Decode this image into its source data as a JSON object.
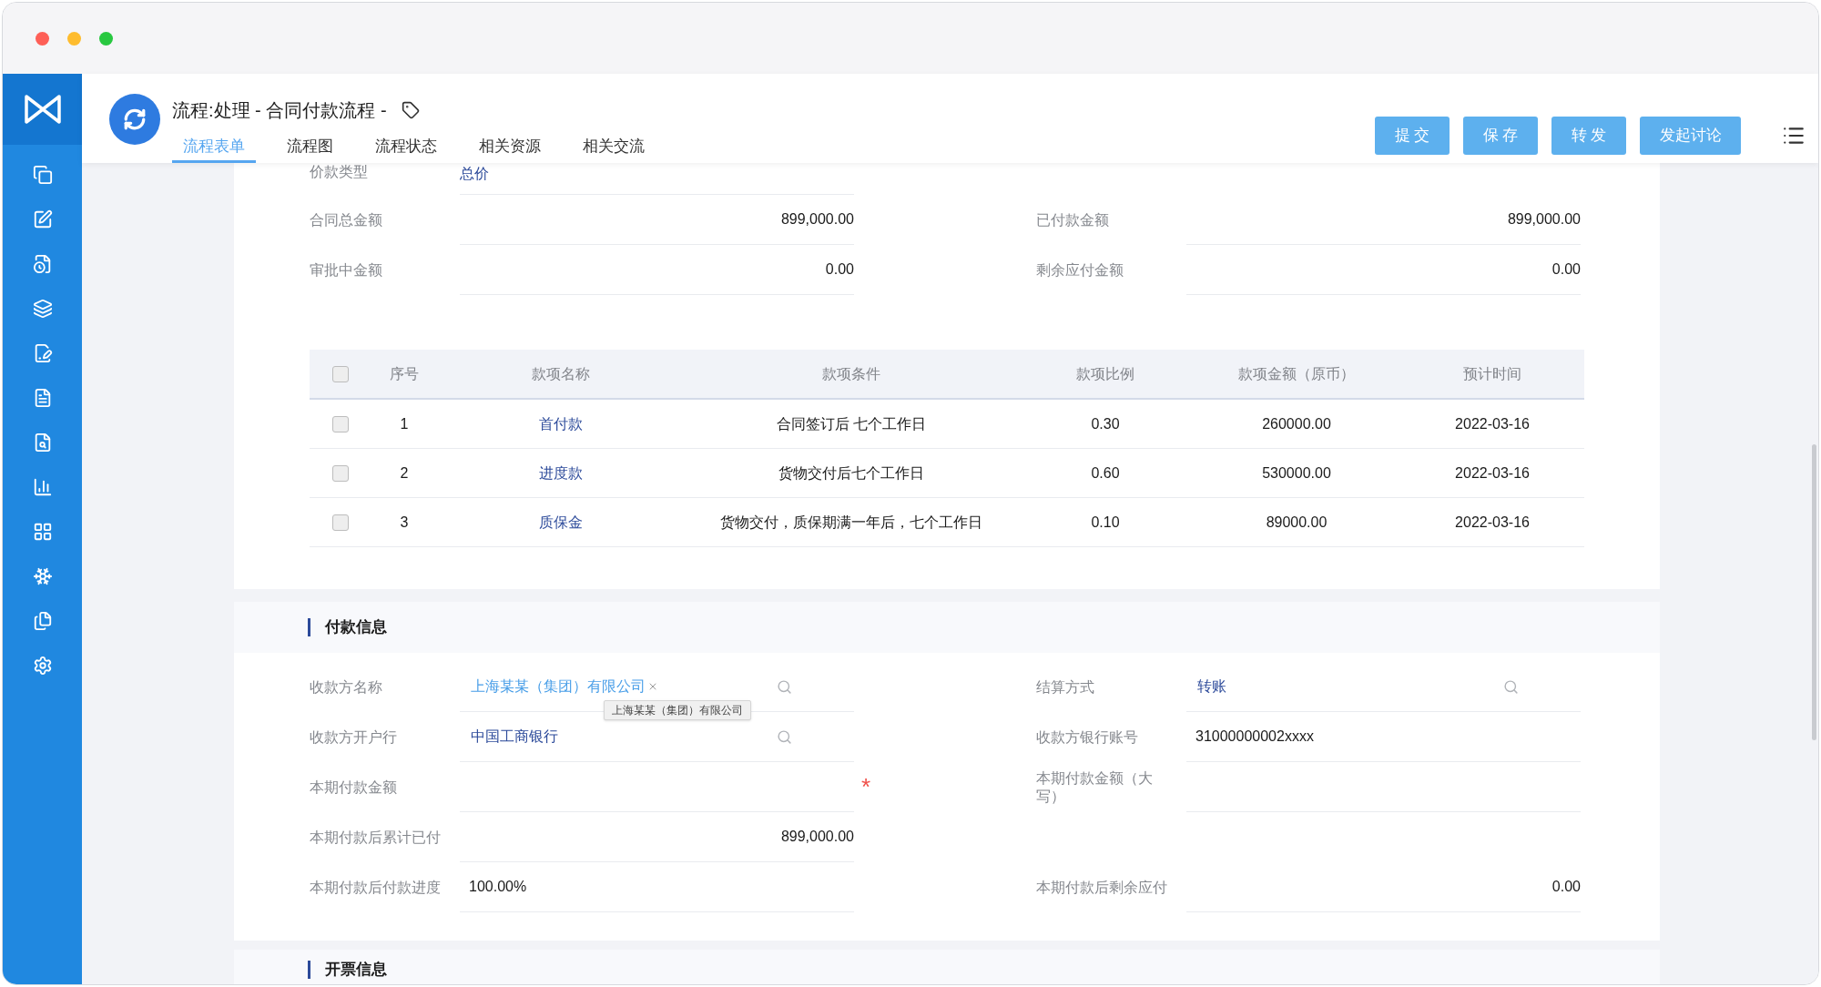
{
  "window": {
    "title": "流程:处理 - 合同付款流程 -"
  },
  "tabs": [
    {
      "label": "流程表单",
      "selected": true
    },
    {
      "label": "流程图",
      "selected": false
    },
    {
      "label": "流程状态",
      "selected": false
    },
    {
      "label": "相关资源",
      "selected": false
    },
    {
      "label": "相关交流",
      "selected": false
    }
  ],
  "actions": [
    "提 交",
    "保 存",
    "转 发",
    "发起讨论"
  ],
  "contract_fields": [
    {
      "left": {
        "label": "价款类型",
        "value": "总价",
        "kind": "link"
      }
    },
    {
      "left": {
        "label": "合同总金额",
        "value": "899,000.00",
        "kind": "amount"
      },
      "right": {
        "label": "已付款金额",
        "value": "899,000.00",
        "kind": "amount"
      }
    },
    {
      "left": {
        "label": "审批中金额",
        "value": "0.00",
        "kind": "amount"
      },
      "right": {
        "label": "剩余应付金额",
        "value": "0.00",
        "kind": "amount"
      }
    }
  ],
  "payment_terms": {
    "all_checked": false,
    "columns": [
      "序号",
      "款项名称",
      "款项条件",
      "款项比例",
      "款项金额（原币）",
      "预计时间"
    ],
    "rows": [
      {
        "checked": false,
        "cells": [
          "1",
          "首付款",
          "合同签订后 七个工作日",
          "0.30",
          "260000.00",
          "2022-03-16"
        ]
      },
      {
        "checked": false,
        "cells": [
          "2",
          "进度款",
          "货物交付后七个工作日",
          "0.60",
          "530000.00",
          "2022-03-16"
        ]
      },
      {
        "checked": false,
        "cells": [
          "3",
          "质保金",
          "货物交付，质保期满一年后，七个工作日",
          "0.10",
          "89000.00",
          "2022-03-16"
        ]
      }
    ]
  },
  "sections": [
    {
      "title": "付款信息",
      "rows": [
        {
          "left": {
            "label": "收款方名称",
            "value": "上海某某（集团）有限公司",
            "kind": "tag",
            "tooltip": "上海某某（集团）有限公司"
          },
          "right": {
            "label": "结算方式",
            "value": "转账",
            "kind": "lookup"
          }
        },
        {
          "left": {
            "label": "收款方开户行",
            "value": "中国工商银行",
            "kind": "lookup"
          },
          "right": {
            "label": "收款方银行账号",
            "value": "31000000002xxxx",
            "kind": "text"
          }
        },
        {
          "left": {
            "label": "本期付款金额",
            "kind": "text",
            "required_mark": "*"
          },
          "right": {
            "label": "本期付款金额（大写）",
            "kind": "text"
          }
        },
        {
          "left": {
            "label": "本期付款后累计已付",
            "value": "899,000.00",
            "kind": "amount"
          }
        },
        {
          "left": {
            "label": "本期付款后付款进度",
            "value": "100.00%",
            "kind": "text"
          },
          "right": {
            "label": "本期付款后剩余应付",
            "value": "0.00",
            "kind": "amount"
          }
        }
      ]
    },
    {
      "title": "开票信息"
    }
  ]
}
